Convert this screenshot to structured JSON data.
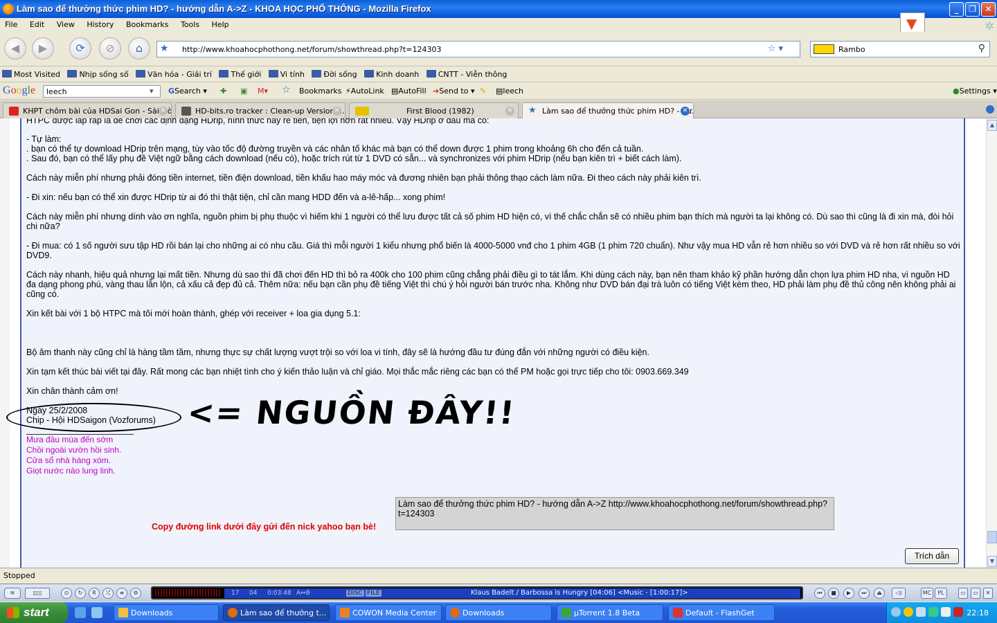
{
  "window": {
    "title": "Làm sao để thưởng thức phim HD? - hướng dẫn A->Z - KHOA HỌC PHỔ THÔNG - Mozilla Firefox"
  },
  "menu": [
    "File",
    "Edit",
    "View",
    "History",
    "Bookmarks",
    "Tools",
    "Help"
  ],
  "nav": {
    "url": "http://www.khoahocphothong.net/forum/showthread.php?t=124303",
    "search_value": "Rambo"
  },
  "bookmarks": [
    "Most Visited",
    "Nhịp sống số",
    "Văn hóa - Giải trí",
    "Thế giới",
    "Vi tính",
    "Đời sống",
    "Kinh doanh",
    "CNTT - Viễn thông"
  ],
  "google": {
    "logo": "Google",
    "query": "leech",
    "search_label": "Search",
    "bookmarks_label": "Bookmarks",
    "autolink_label": "AutoLink",
    "autofill_label": "AutoFill",
    "sendto_label": "Send to",
    "leech_label": "leech",
    "settings_label": "Settings"
  },
  "tabs": [
    {
      "label": "KHPT chôm bài của HDSai Gon - Sài Gò...",
      "icon_color": "#d22"
    },
    {
      "label": "HD-bits.ro tracker : Clean-up Version :...",
      "icon_color": "#555"
    },
    {
      "label": "First Blood (1982)",
      "icon_color": "#e5c100"
    },
    {
      "label": "Làm sao để thưởng thức phim HD? - hư...",
      "icon_color": "#2f6fc7"
    }
  ],
  "post": {
    "paragraphs": [
      "HTPC được lắp ráp là để chơi các định dạng HDrip, hình thức này rẻ tiền, tiện lợi hơn rất nhiều. Vậy HDrip ở đâu mà có:",
      "- Tự làm:",
      ". bạn có thể tự download HDrip trên mạng, tùy vào tốc độ đường truyền và các nhân tố khác mà bạn có thể down được 1 phim trong khoảng 6h cho đến cả tuần.",
      ". Sau đó, bạn có thể lấy phụ đề Việt ngữ bằng cách download (nếu có), hoặc trích rút từ 1 DVD có sẵn... và synchronizes với phim HDrip (nếu bạn kiên trì + biết cách làm).",
      "Cách này miễn phí nhưng phải đóng tiền internet, tiền điện download, tiền khấu hao máy móc và đương nhiên bạn phải thông thạo cách làm nữa. Đi theo cách này phải kiên trì.",
      "- Đi xin: nếu bạn có thể xin được HDrip từ ai đó thì thật tiện, chỉ cần mang HDD đến và a-lê-hấp... xong phim!",
      "Cách này miễn phí nhưng dính vào ơn nghĩa, nguồn phim bị phụ thuộc vì hiếm khi 1 người có thể lưu được tất cả số phim HD hiện có, vì thế chắc chắn sẽ có nhiều phim bạn thích mà người ta lại không có. Dù sao thì cũng là đi xin mà, đòi hỏi chi nữa?",
      "- Đi mua: có 1 số người sưu tập HD rồi bán lại cho những ai có nhu cầu. Giá thì mỗi người 1 kiểu nhưng phổ biến là 4000-5000 vnđ cho 1 phim 4GB (1 phim 720 chuẩn). Như vậy mua HD vẫn rẻ hơn nhiều so với DVD và rẻ hơn rất nhiều so với DVD9.",
      "Cách này nhanh, hiệu quả nhưng lại mất tiền. Nhưng dù sao thì đã chơi đến HD thì bỏ ra 400k cho 100 phim cũng chẳng phải điều gì to tát lắm. Khi dùng cách này, bạn nên tham khảo kỹ phần hướng dẫn chọn lựa phim HD nha, vì nguồn HD đa dạng phong phú, vàng thau lẫn lộn, cả xấu cả đẹp đủ cả. Thêm nữa: nếu bạn cần phụ đề tiếng Việt thì chú ý hỏi người bán trước nha. Không như DVD bán đại trà luôn có tiếng Việt kèm theo, HD phải làm phụ đề thủ công nên không phải ai cũng có.",
      "Xin kết bài với 1 bộ HTPC mà tôi mới hoàn thành, ghép với receiver + loa gia dụng 5.1:",
      "Bộ âm thanh này cũng chỉ là hàng tầm tầm, nhưng thực sự chất lượng vượt trội so với loa vi tính, đây sẽ là hướng đầu tư đúng đắn với những người có điều kiện.",
      "Xin tạm kết thúc bài viết tại đây. Rất mong các bạn nhiệt tình cho ý kiến thảo luận và chỉ giáo. Mọi thắc mắc riêng các bạn có thể PM hoặc gọi trực tiếp cho tôi: 0903.669.349",
      "Xin chân thành cảm ơn!",
      "Ngày 25/2/2008",
      "Chip - Hội HDSaigon (Vozforums)"
    ],
    "annotation": "<= NGUỒN ĐÂY!!",
    "signature": [
      "Mưa đầu mùa đến sớm",
      "Chồi ngoài vườn hồi sinh.",
      "Cửa sổ nhà hàng xóm.",
      "Giọt nước nào lung linh."
    ],
    "copy_label": "Copy đường link dưới đây gửi đến nick yahoo bạn bè!",
    "copy_text": "Làm sao để thưởng thức phim HD? - hướng dẫn A->Z http://www.khoahocphothong.net/forum/showthread.php?t=124303",
    "quote_button": "Trích dẫn"
  },
  "status": "Stopped",
  "player": {
    "counter_a": "17",
    "counter_b": "04",
    "time": "0:03:48",
    "ab": "A⇔B",
    "track": "Klaus Badelt / Barbossa is Hungry  [04:06]   <Music - [1:00:17]>",
    "disc": "DISC",
    "file": "FILE"
  },
  "taskbar": {
    "start": "start",
    "tasks": [
      {
        "label": "Downloads",
        "icon_color": "#f0c040"
      },
      {
        "label": "Làm sao để thưởng t...",
        "icon_color": "#e06a10"
      },
      {
        "label": "COWON Media Center",
        "icon_color": "#f08020"
      },
      {
        "label": "Downloads",
        "icon_color": "#e06a10"
      },
      {
        "label": "µTorrent 1.8 Beta",
        "icon_color": "#3aa53a"
      },
      {
        "label": "Default - FlashGet",
        "icon_color": "#d33"
      }
    ],
    "clock": "22:18"
  }
}
